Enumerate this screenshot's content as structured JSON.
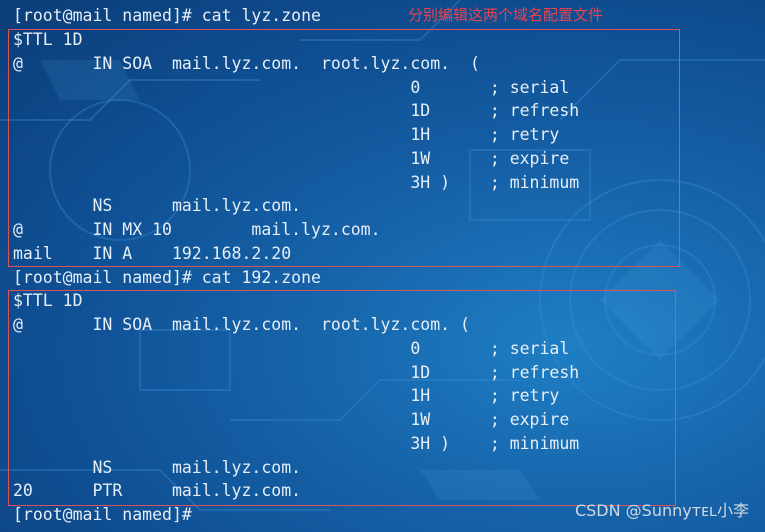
{
  "annotation": "分别编辑这两个域名配置文件",
  "watermark": "CSDN @Sunnyᴛᴇʟ小李",
  "terminal": {
    "lines": [
      "[root@mail named]# cat lyz.zone",
      "$TTL 1D",
      "@       IN SOA  mail.lyz.com.  root.lyz.com.  (",
      "                                        0       ; serial",
      "                                        1D      ; refresh",
      "                                        1H      ; retry",
      "                                        1W      ; expire",
      "                                        3H )    ; minimum",
      "        NS      mail.lyz.com.",
      "@       IN MX 10        mail.lyz.com.",
      "mail    IN A    192.168.2.20",
      "[root@mail named]# cat 192.zone",
      "$TTL 1D",
      "@       IN SOA  mail.lyz.com.  root.lyz.com. (",
      "                                        0       ; serial",
      "                                        1D      ; refresh",
      "                                        1H      ; retry",
      "                                        1W      ; expire",
      "                                        3H )    ; minimum",
      "        NS      mail.lyz.com.",
      "20      PTR     mail.lyz.com.",
      "[root@mail named]#"
    ]
  }
}
